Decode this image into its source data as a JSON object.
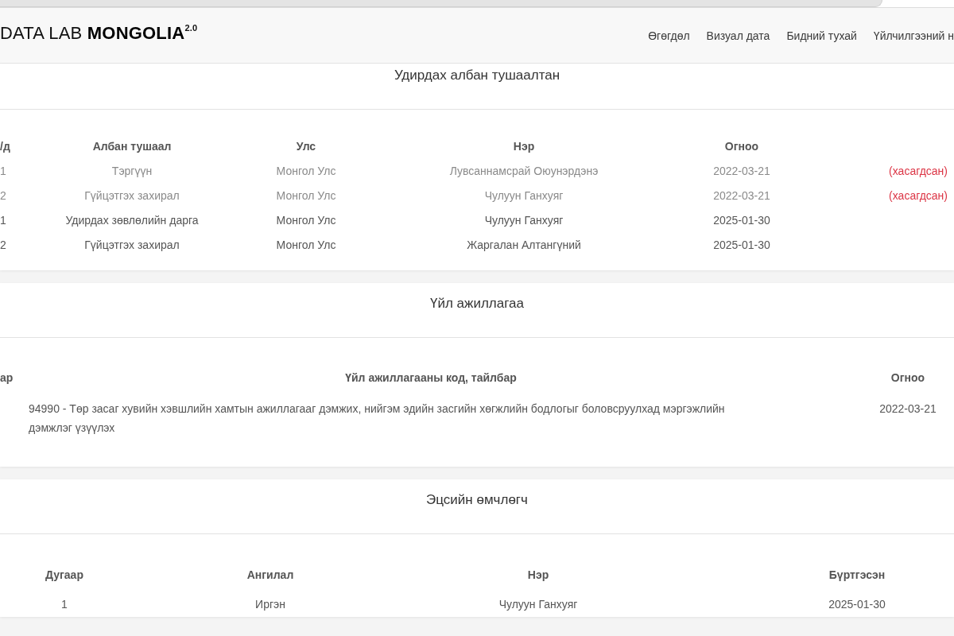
{
  "navbar": {
    "brand": "DATA LAB **MONGOLIA**$^{2.0}$",
    "links": [
      {
        "label": "Өгөгдөл"
      },
      {
        "label": "Визуал дата"
      },
      {
        "label": "Бидний тухай"
      },
      {
        "label": "Үйлчилгээний н"
      }
    ]
  },
  "sections": [
    {
      "title": "Удирдах албан тушаалтан",
      "table": {
        "columns": [
          "/д",
          "Албан тушаал",
          "Улс",
          "Нэр",
          "Огноо"
        ],
        "rows": [
          {
            "cells": [
              "1",
              "Тэргүүн",
              "Монгол Улс",
              "Лувсаннамсрай Оюунэрдэнэ",
              "2022-03-21"
            ],
            "removed": true,
            "note": "(хасагдсан)"
          },
          {
            "cells": [
              "2",
              "Гүйцэтгэх захирал",
              "Монгол Улс",
              "Чулуун Ганхуяг",
              "2022-03-21"
            ],
            "removed": true,
            "note": "(хасагдсан)"
          },
          {
            "cells": [
              "1",
              "Удирдах зөвлөлийн дарга",
              "Монгол Улс",
              "Чулуун Ганхуяг",
              "2025-01-30"
            ],
            "removed": false
          },
          {
            "cells": [
              "2",
              "Гүйцэтгэх захирал",
              "Монгол Улс",
              "Жаргалан Алтангүний",
              "2025-01-30"
            ],
            "removed": false
          }
        ]
      }
    },
    {
      "title": "Үйл ажиллагаа",
      "table": {
        "columns": [
          "ар",
          "Үйл ажиллагааны код, тайлбар",
          "Огноо"
        ],
        "rows": [
          {
            "cells": [
              null,
              "94990 - Төр засаг хувийн хэвшлийн хамтын ажиллагааг дэмжих, нийгэм эдийн засгийн хөгжлийн бодлогыг боловсруулхад мэргэжлийн дэмжлэг үзүүлэх",
              "2022-03-21"
            ]
          }
        ]
      }
    },
    {
      "title": "Эцсийн өмчлөгч",
      "table": {
        "columns": [
          "Дугаар",
          "Ангилал",
          "Нэр",
          "Бүртгэсэн"
        ],
        "rows": [
          {
            "cells": [
              "1",
              "Иргэн",
              "Чулуун Ганхуяг",
              "2025-01-30"
            ]
          }
        ]
      }
    }
  ]
}
